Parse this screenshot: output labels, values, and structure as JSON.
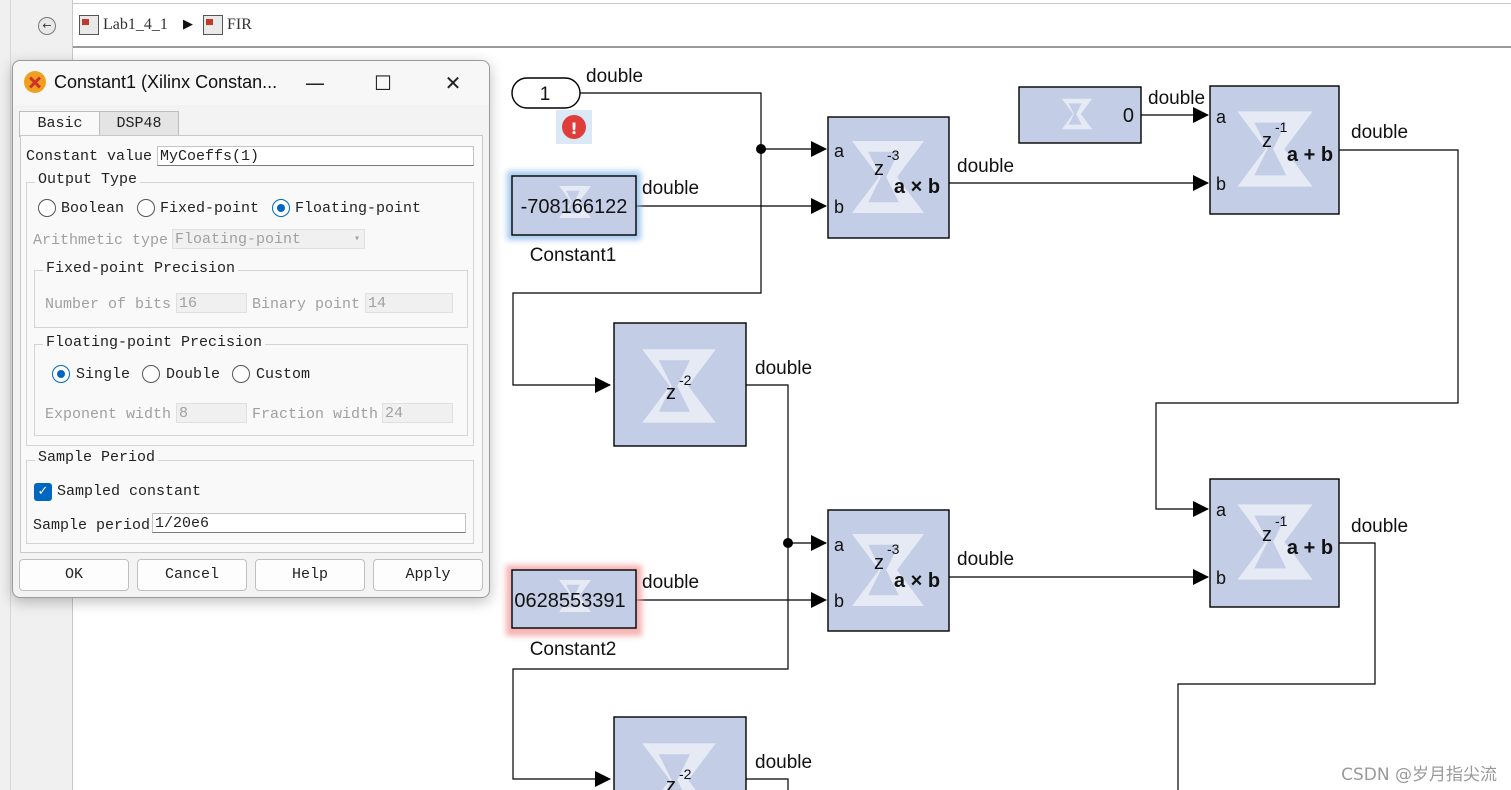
{
  "breadcrumb": {
    "root": "Lab1_4_1",
    "child": "FIR"
  },
  "diagram": {
    "signal_type": "double",
    "inport_value": "1",
    "constant1_label": "Constant1",
    "constant1_text": "-708166122",
    "constant2_label": "Constant2",
    "constant2_text": "0628553391",
    "zero_constant_value": "0",
    "mult_delay": "z",
    "mult_delay_exp": "-3",
    "mult_op": "a × b",
    "add_delay": "z",
    "add_delay_exp": "-1",
    "add_op": "a + b",
    "delay_z": "z",
    "delay_exp": "-2",
    "port_a": "a",
    "port_b": "b"
  },
  "dialog": {
    "title": "Constant1  (Xilinx Constan...",
    "tabs": [
      "Basic",
      "DSP48"
    ],
    "constant_value_label": "Constant value",
    "constant_value": "MyCoeffs(1)",
    "output_type_title": "Output Type",
    "output_types": [
      "Boolean",
      "Fixed-point",
      "Floating-point"
    ],
    "output_type_selected": "Floating-point",
    "arithmetic_type_label": "Arithmetic type",
    "arithmetic_type_value": "Floating-point",
    "fixed_precision_title": "Fixed-point Precision",
    "number_of_bits_label": "Number of bits",
    "number_of_bits": "16",
    "binary_point_label": "Binary point",
    "binary_point": "14",
    "float_precision_title": "Floating-point Precision",
    "precisions": [
      "Single",
      "Double",
      "Custom"
    ],
    "precision_selected": "Single",
    "exponent_width_label": "Exponent width",
    "exponent_width": "8",
    "fraction_width_label": "Fraction width",
    "fraction_width": "24",
    "sample_period_title": "Sample Period",
    "sampled_constant_label": "Sampled constant",
    "sampled_constant_checked": true,
    "sample_period_label": "Sample period",
    "sample_period": "1/20e6",
    "buttons": {
      "ok": "OK",
      "cancel": "Cancel",
      "help": "Help",
      "apply": "Apply"
    }
  },
  "watermark": "CSDN @岁月指尖流",
  "colors": {
    "block_fill": "#c4cde6",
    "accent": "#0067c0",
    "error": "#e03c3c"
  }
}
